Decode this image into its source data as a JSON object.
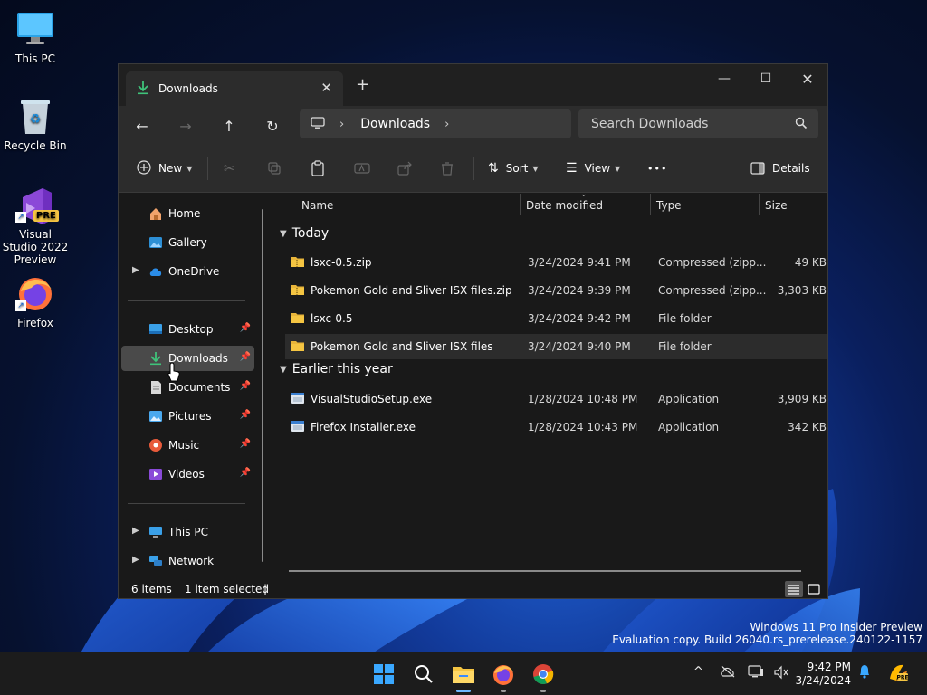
{
  "desktop": {
    "icons": [
      {
        "label": "This PC"
      },
      {
        "label": "Recycle Bin"
      },
      {
        "label": "Visual Studio 2022 Preview",
        "badge": "PRE"
      },
      {
        "label": "Firefox"
      }
    ],
    "watermark": {
      "line1": "Windows 11 Pro Insider Preview",
      "line2": "Evaluation copy. Build 26040.rs_prerelease.240122-1157"
    }
  },
  "window": {
    "tab_title": "Downloads",
    "tab_close": "✕",
    "new_tab": "+",
    "controls": {
      "minimize": "—",
      "maximize": "☐",
      "close": "✕"
    },
    "nav": {
      "back": "←",
      "forward": "→",
      "up": "↑",
      "refresh": "↻"
    },
    "address": {
      "crumb": "Downloads",
      "sep": "›"
    },
    "search": {
      "placeholder": "Search Downloads"
    },
    "toolbar": {
      "new_label": "New",
      "sort_label": "Sort",
      "view_label": "View",
      "more_label": "•••",
      "details_label": "Details"
    },
    "sidebar": {
      "home": "Home",
      "gallery": "Gallery",
      "onedrive": "OneDrive",
      "desktop": "Desktop",
      "downloads": "Downloads",
      "documents": "Documents",
      "pictures": "Pictures",
      "music": "Music",
      "videos": "Videos",
      "thispc": "This PC",
      "network": "Network"
    },
    "columns": {
      "name": "Name",
      "date": "Date modified",
      "type": "Type",
      "size": "Size"
    },
    "groups": [
      {
        "label": "Today",
        "files": [
          {
            "name": "lsxc-0.5.zip",
            "date": "3/24/2024 9:41 PM",
            "type": "Compressed (zipp...",
            "size": "49 KB",
            "kind": "zip"
          },
          {
            "name": "Pokemon Gold and Sliver ISX files.zip",
            "date": "3/24/2024 9:39 PM",
            "type": "Compressed (zipp...",
            "size": "3,303 KB",
            "kind": "zip"
          },
          {
            "name": "lsxc-0.5",
            "date": "3/24/2024 9:42 PM",
            "type": "File folder",
            "size": "",
            "kind": "folder"
          },
          {
            "name": "Pokemon Gold and Sliver ISX files",
            "date": "3/24/2024 9:40 PM",
            "type": "File folder",
            "size": "",
            "kind": "folder"
          }
        ]
      },
      {
        "label": "Earlier this year",
        "files": [
          {
            "name": "VisualStudioSetup.exe",
            "date": "1/28/2024 10:48 PM",
            "type": "Application",
            "size": "3,909 KB",
            "kind": "exe"
          },
          {
            "name": "Firefox Installer.exe",
            "date": "1/28/2024 10:43 PM",
            "type": "Application",
            "size": "342 KB",
            "kind": "exe"
          }
        ]
      }
    ],
    "status": {
      "items": "6 items",
      "selected": "1 item selected",
      "caret": "|"
    }
  },
  "taskbar": {
    "time": "9:42 PM",
    "date": "3/24/2024",
    "tray_chevron": "^"
  },
  "colors": {
    "accent": "#6cb8ff",
    "folder": "#f5c542",
    "selection": "#4a4a4a"
  }
}
